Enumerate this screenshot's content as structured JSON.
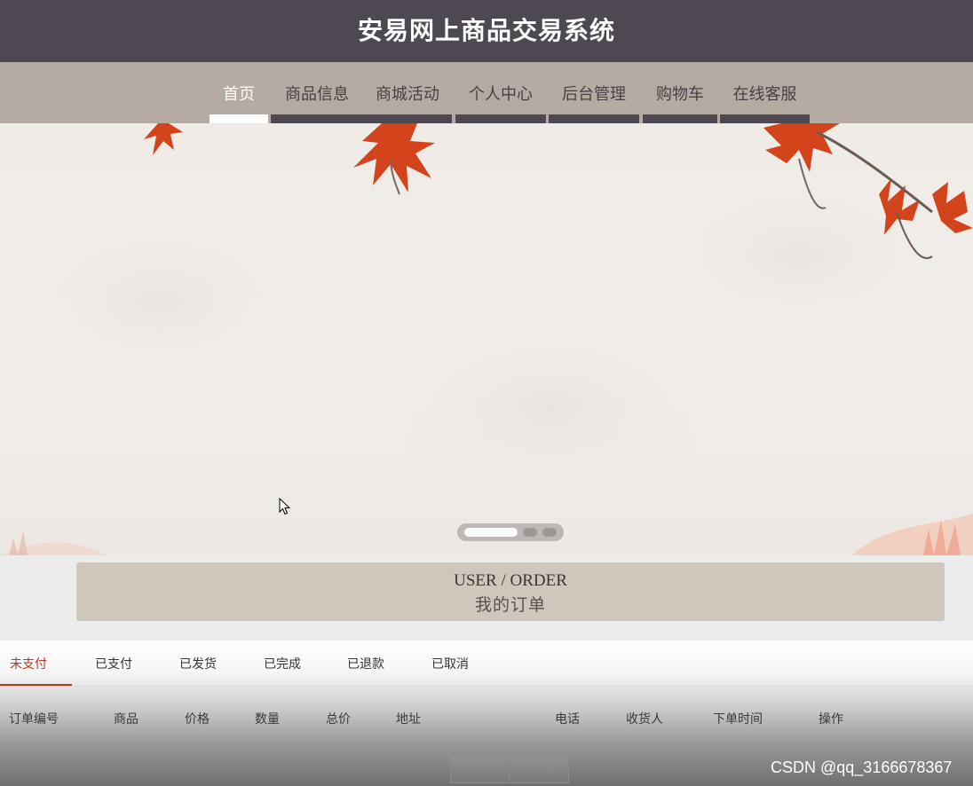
{
  "header": {
    "title": "安易网上商品交易系统"
  },
  "nav": {
    "items": [
      {
        "label": "首页",
        "active": true
      },
      {
        "label": "商品信息",
        "active": false
      },
      {
        "label": "商城活动",
        "active": false
      },
      {
        "label": "个人中心",
        "active": false
      },
      {
        "label": "后台管理",
        "active": false
      },
      {
        "label": "购物车",
        "active": false
      },
      {
        "label": "在线客服",
        "active": false
      }
    ]
  },
  "banner": {
    "slide_count": 3,
    "active_slide": 1
  },
  "section": {
    "title_en": "USER / ORDER",
    "title_zh": "我的订单"
  },
  "orders": {
    "tabs": [
      {
        "label": "未支付",
        "active": true
      },
      {
        "label": "已支付",
        "active": false
      },
      {
        "label": "已发货",
        "active": false
      },
      {
        "label": "已完成",
        "active": false
      },
      {
        "label": "已退款",
        "active": false
      },
      {
        "label": "已取消",
        "active": false
      }
    ],
    "columns": [
      "订单编号",
      "商品",
      "价格",
      "数量",
      "总价",
      "地址",
      "电话",
      "收货人",
      "下单时间",
      "操作"
    ],
    "rows": []
  },
  "pager": {
    "prev_label": "上一页",
    "next_label": "下一页"
  },
  "watermark": {
    "text": "CSDN @qq_3166678367"
  },
  "colors": {
    "header_bg": "#4e4853",
    "nav_bg": "#b6aba2",
    "accent": "#b23a20",
    "section_bg": "#cfc6bc"
  }
}
